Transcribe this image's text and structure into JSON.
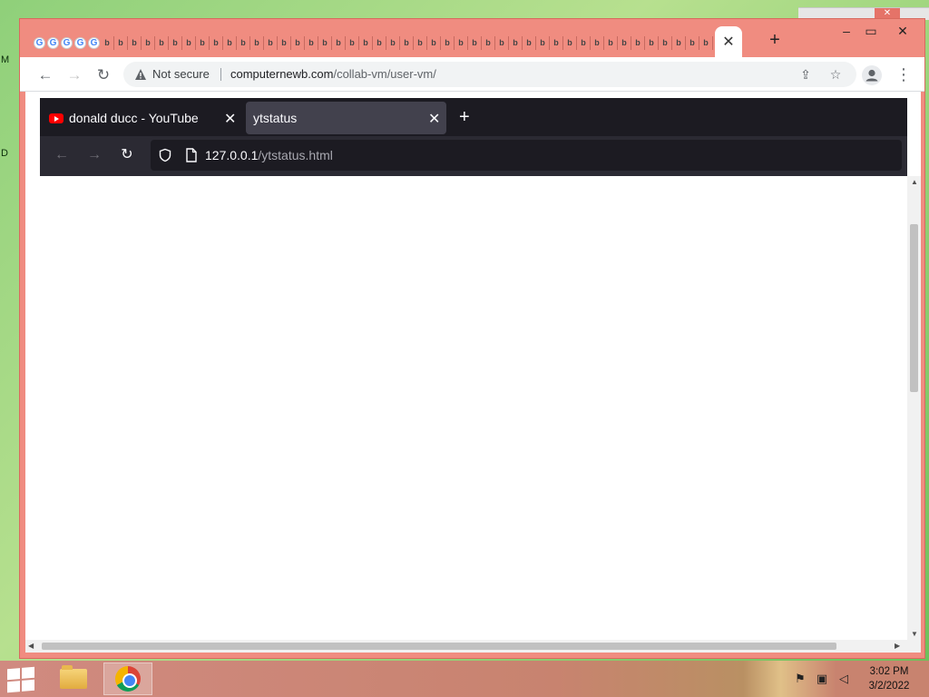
{
  "desktop": {
    "letters": [
      "M",
      "D"
    ]
  },
  "chrome": {
    "tab_strip": {
      "mini_tabs": [
        "G",
        "G",
        "G",
        "G",
        "G",
        "b",
        "b",
        "b",
        "b",
        "b",
        "b",
        "b",
        "b",
        "b",
        "b",
        "b",
        "b",
        "b",
        "b",
        "b",
        "b",
        "b",
        "b",
        "b",
        "b",
        "b",
        "b",
        "b",
        "b",
        "b",
        "b",
        "b",
        "b",
        "b",
        "b",
        "b",
        "b",
        "b",
        "b",
        "b",
        "b",
        "b",
        "b",
        "b",
        "b",
        "b",
        "b",
        "b",
        "b",
        "b",
        "b",
        "b",
        "b",
        "b",
        "b"
      ],
      "active_tab_close": "✕",
      "new_tab": "+"
    },
    "window_controls": {
      "minimize": "–",
      "maximize": "▭",
      "close": "✕"
    },
    "toolbar": {
      "back": "←",
      "forward": "→",
      "reload": "↻",
      "security_label": "Not secure",
      "url_host": "computernewb.com",
      "url_path": "/collab-vm/user-vm/",
      "share_icon": "⇪",
      "bookmark_icon": "☆",
      "menu": "⋮"
    }
  },
  "inner_browser": {
    "tabs": [
      {
        "label": "donald ducc - YouTube",
        "close": "✕"
      },
      {
        "label": "ytstatus",
        "close": "✕"
      }
    ],
    "new_tab": "+",
    "nav": {
      "back": "←",
      "forward": "→",
      "reload": "↻"
    },
    "url_host": "127.0.0.1",
    "url_path": "/ytstatus.html"
  },
  "taskbar": {
    "time": "3:02 PM",
    "date": "3/2/2022"
  }
}
